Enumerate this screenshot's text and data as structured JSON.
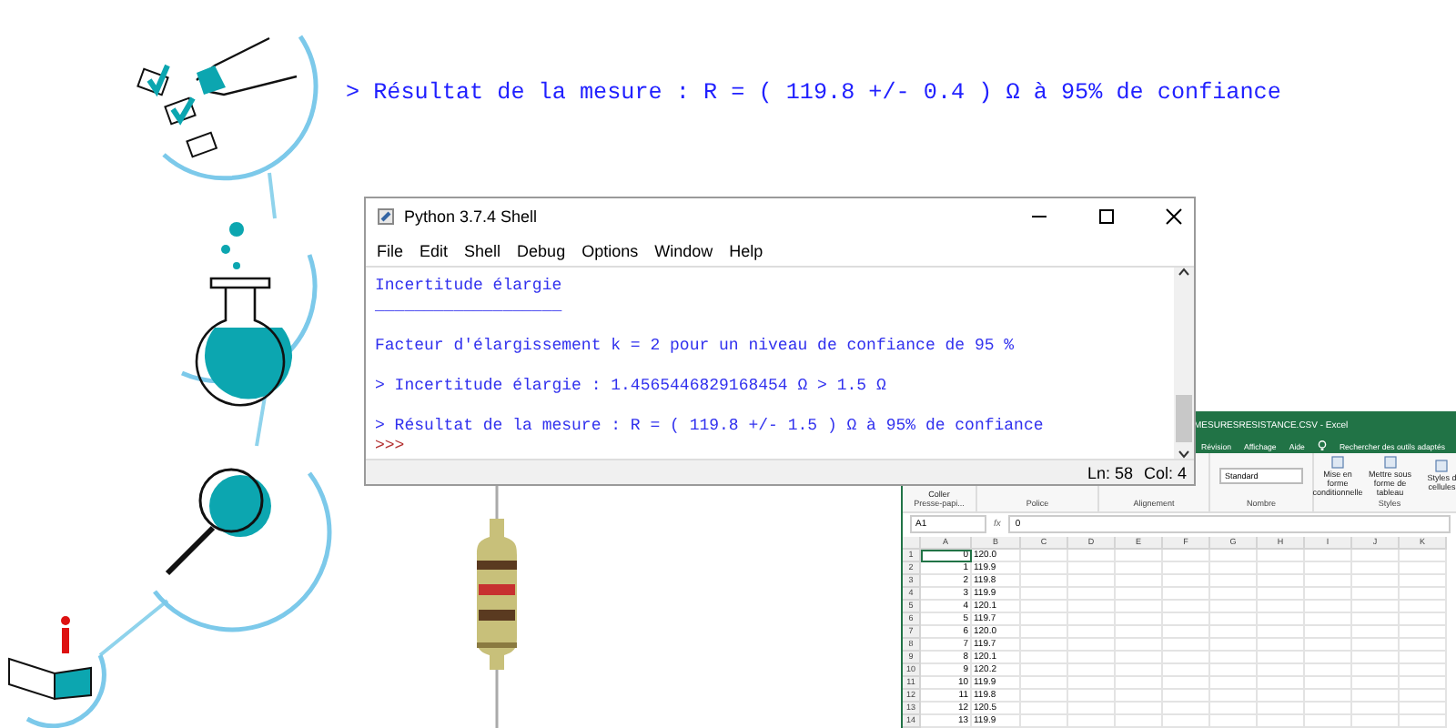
{
  "headline": "> Résultat de la mesure : R = ( 119.8 +/- 0.4 ) Ω à 95% de confiance",
  "shell": {
    "title": "Python 3.7.4 Shell",
    "menu": [
      "File",
      "Edit",
      "Shell",
      "Debug",
      "Options",
      "Window",
      "Help"
    ],
    "lines": [
      {
        "kind": "output",
        "text": "Incertitude élargie"
      },
      {
        "kind": "output",
        "text": "___________________"
      },
      {
        "kind": "blank"
      },
      {
        "kind": "output",
        "text": "Facteur d'élargissement k = 2 pour un niveau de confiance de 95 %"
      },
      {
        "kind": "blank"
      },
      {
        "kind": "output",
        "text": "> Incertitude élargie : 1.4565446829168454 Ω > 1.5 Ω"
      },
      {
        "kind": "blank"
      },
      {
        "kind": "output",
        "text": "> Résultat de la mesure : R = ( 119.8 +/- 1.5 ) Ω à 95% de confiance"
      },
      {
        "kind": "prompt",
        "text": ">>>"
      }
    ],
    "status": [
      "Ln: 58",
      "Col: 4"
    ]
  },
  "excel": {
    "title": "MESURESRESISTANCE.CSV - Excel",
    "tabs": [
      "Révision",
      "Affichage",
      "Aide"
    ],
    "search": "Rechercher des outils adaptés",
    "groups": [
      {
        "kind": "clipboard",
        "label": "Presse-papi...",
        "items": [
          "Coller"
        ]
      },
      {
        "kind": "font",
        "label": "Police"
      },
      {
        "kind": "align",
        "label": "Alignement"
      },
      {
        "kind": "number",
        "label": "Nombre",
        "items": [
          "Standard"
        ]
      },
      {
        "kind": "styles",
        "label": "Styles",
        "items": [
          "Mise en forme conditionnelle",
          "Mettre sous forme de tableau",
          "Styles d cellules"
        ]
      }
    ],
    "name_box": "A1",
    "fx": "fx",
    "formula": "0",
    "columns": [
      "A",
      "B",
      "C",
      "D",
      "E",
      "F",
      "G",
      "H",
      "I",
      "J",
      "K"
    ],
    "rows": [
      {
        "n": "1",
        "a": "0",
        "b": "120.0",
        "selected": true
      },
      {
        "n": "2",
        "a": "1",
        "b": "119.9",
        "selected": false
      },
      {
        "n": "3",
        "a": "2",
        "b": "119.8",
        "selected": false
      },
      {
        "n": "4",
        "a": "3",
        "b": "119.9",
        "selected": false
      },
      {
        "n": "5",
        "a": "4",
        "b": "120.1",
        "selected": false
      },
      {
        "n": "6",
        "a": "5",
        "b": "119.7",
        "selected": false
      },
      {
        "n": "7",
        "a": "6",
        "b": "120.0",
        "selected": false
      },
      {
        "n": "8",
        "a": "7",
        "b": "119.7",
        "selected": false
      },
      {
        "n": "9",
        "a": "8",
        "b": "120.1",
        "selected": false
      },
      {
        "n": "10",
        "a": "9",
        "b": "120.2",
        "selected": false
      },
      {
        "n": "11",
        "a": "10",
        "b": "119.9",
        "selected": false
      },
      {
        "n": "12",
        "a": "11",
        "b": "119.8",
        "selected": false
      },
      {
        "n": "13",
        "a": "12",
        "b": "120.5",
        "selected": false
      },
      {
        "n": "14",
        "a": "13",
        "b": "119.9",
        "selected": false
      }
    ]
  }
}
